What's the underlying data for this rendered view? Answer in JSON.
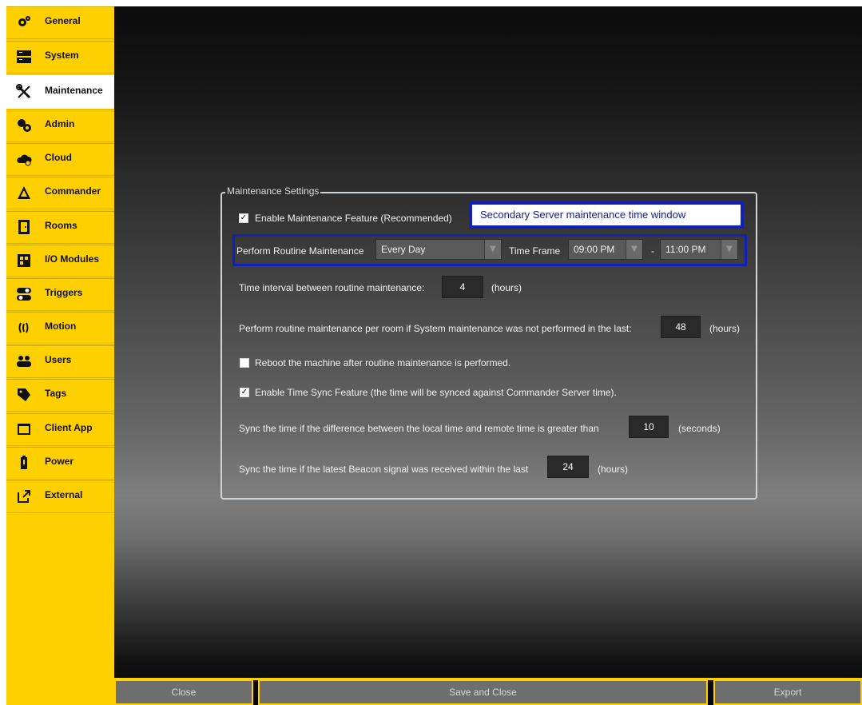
{
  "sidebar": {
    "items": [
      {
        "label": "General",
        "icon": "gear-icon"
      },
      {
        "label": "System",
        "icon": "server-icon"
      },
      {
        "label": "Maintenance",
        "icon": "tools-icon"
      },
      {
        "label": "Admin",
        "icon": "admin-icon"
      },
      {
        "label": "Cloud",
        "icon": "cloud-icon"
      },
      {
        "label": "Commander",
        "icon": "commander-icon"
      },
      {
        "label": "Rooms",
        "icon": "door-icon"
      },
      {
        "label": "I/O Modules",
        "icon": "module-icon"
      },
      {
        "label": "Triggers",
        "icon": "toggle-icon"
      },
      {
        "label": "Motion",
        "icon": "motion-icon"
      },
      {
        "label": "Users",
        "icon": "users-icon"
      },
      {
        "label": "Tags",
        "icon": "tag-icon"
      },
      {
        "label": "Client App",
        "icon": "app-window-icon"
      },
      {
        "label": "Power",
        "icon": "battery-icon"
      },
      {
        "label": "External",
        "icon": "external-link-icon"
      }
    ],
    "active": "Maintenance"
  },
  "maintenance": {
    "title": "Maintenance Settings",
    "enable_feature_label": "Enable Maintenance Feature (Recommended)",
    "enable_feature_checked": true,
    "tooltip": "Secondary Server maintenance time window",
    "routine_label": "Perform Routine Maintenance",
    "routine_frequency": "Every Day",
    "time_frame_label": "Time Frame",
    "time_start": "09:00 PM",
    "time_separator": "-",
    "time_end": "11:00 PM",
    "interval_label": "Time interval between routine maintenance:",
    "interval_value": "4",
    "interval_unit": "(hours)",
    "room_label": "Perform routine maintenance per room if System maintenance was not performed in the last:",
    "room_value": "48",
    "room_unit": "(hours)",
    "reboot_label": "Reboot the machine after routine maintenance is performed.",
    "reboot_checked": false,
    "sync_label": "Enable Time Sync Feature (the time will be synced against Commander Server time).",
    "sync_checked": true,
    "diff_label": "Sync the time if the difference between the local time and remote time is greater than",
    "diff_value": "10",
    "diff_unit": "(seconds)",
    "beacon_label": "Sync the time if the latest Beacon signal was received within the last",
    "beacon_value": "24",
    "beacon_unit": "(hours)"
  },
  "footer": {
    "close": "Close",
    "save_close": "Save and Close",
    "export": "Export"
  },
  "colors": {
    "sidebar": "#ffd000",
    "highlight": "#1020b8",
    "tooltip_text": "#111d8e"
  }
}
